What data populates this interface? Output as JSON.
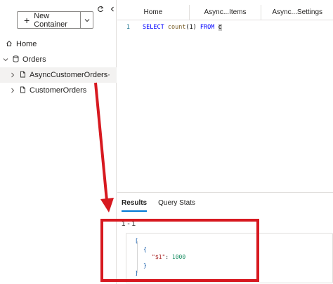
{
  "sidebar": {
    "new_container_label": "New Container",
    "items": [
      {
        "label": "Home",
        "icon": "home-icon"
      },
      {
        "label": "Orders",
        "icon": "database-icon"
      },
      {
        "label": "AsyncCustomerOrders",
        "icon": "container-icon",
        "more": "···"
      },
      {
        "label": "CustomerOrders",
        "icon": "container-icon"
      }
    ]
  },
  "tabs": [
    {
      "label": "Home"
    },
    {
      "label": "Async...Items"
    },
    {
      "label": "Async...Settings"
    }
  ],
  "editor": {
    "line_number": "1",
    "query": {
      "select": "SELECT",
      "fn": "count",
      "args": "(1)",
      "from": "FROM",
      "alias": "c"
    }
  },
  "results": {
    "tabs": [
      {
        "label": "Results",
        "active": true
      },
      {
        "label": "Query Stats",
        "active": false
      }
    ],
    "range": "1 - 1",
    "json": {
      "open_array": "[",
      "open_obj": "{",
      "key": "\"$1\"",
      "colon": ": ",
      "value": "1000",
      "close_obj": "}",
      "close_array": "]"
    }
  },
  "colors": {
    "annotation": "#d71920",
    "accent": "#0078d4"
  }
}
